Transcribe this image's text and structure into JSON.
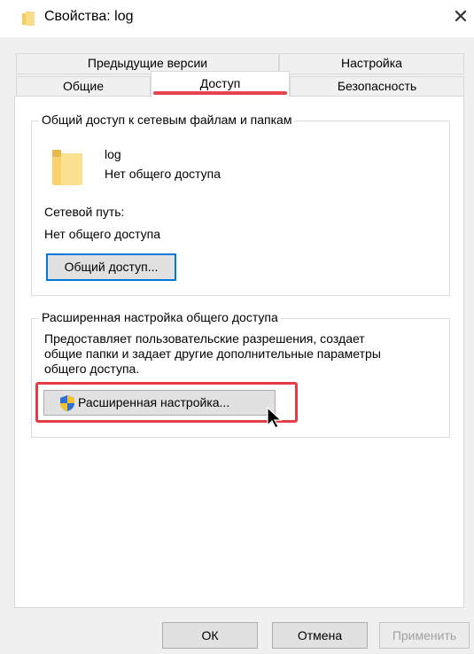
{
  "window": {
    "title": "Свойства: log"
  },
  "tabs": {
    "row1": [
      "Предыдущие версии",
      "Настройка"
    ],
    "row2": [
      "Общие",
      "Доступ",
      "Безопасность"
    ],
    "selected": "Доступ"
  },
  "network_sharing": {
    "group_title": "Общий доступ к сетевым файлам и папкам",
    "folder_name": "log",
    "folder_status": "Нет общего доступа",
    "network_path_label": "Сетевой путь:",
    "network_path_value": "Нет общего доступа",
    "share_button": "Общий доступ..."
  },
  "advanced_sharing": {
    "group_title": "Расширенная настройка общего доступа",
    "description_line1": "Предоставляет пользовательские разрешения, создает",
    "description_line2": "общие папки и задает другие дополнительные параметры",
    "description_line3": "общего доступа.",
    "advanced_button": "Расширенная настройка..."
  },
  "footer": {
    "ok": "ОК",
    "cancel": "Отмена",
    "apply": "Применить"
  },
  "colors": {
    "accent": "#0078d7",
    "highlight": "#e43c46",
    "folder": "#f8d775"
  },
  "icons": [
    "folder-icon",
    "close-icon",
    "shield-icon",
    "cursor-icon"
  ]
}
